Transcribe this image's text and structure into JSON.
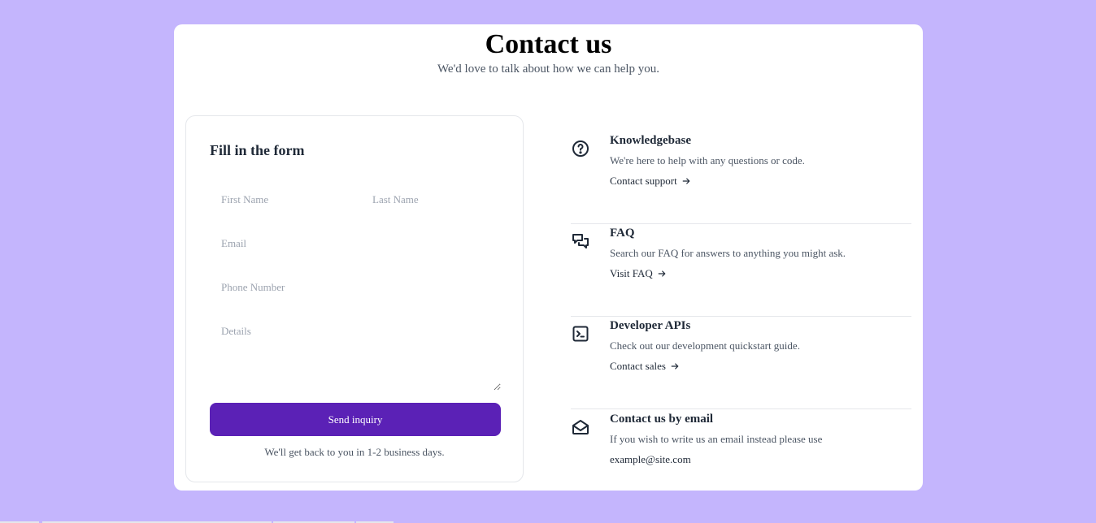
{
  "header": {
    "title": "Contact us",
    "subtitle": "We'd love to talk about how we can help you."
  },
  "form": {
    "heading": "Fill in the form",
    "first_name_placeholder": "First Name",
    "last_name_placeholder": "Last Name",
    "email_placeholder": "Email",
    "phone_placeholder": "Phone Number",
    "details_placeholder": "Details",
    "submit_label": "Send inquiry",
    "note": "We'll get back to you in 1-2 business days."
  },
  "info": {
    "items": [
      {
        "icon": "help-circle-icon",
        "title": "Knowledgebase",
        "description": "We're here to help with any questions or code.",
        "link": "Contact support"
      },
      {
        "icon": "chat-bubbles-icon",
        "title": "FAQ",
        "description": "Search our FAQ for answers to anything you might ask.",
        "link": "Visit FAQ"
      },
      {
        "icon": "terminal-icon",
        "title": "Developer APIs",
        "description": "Check out our development quickstart guide.",
        "link": "Contact sales"
      },
      {
        "icon": "open-envelope-icon",
        "title": "Contact us by email",
        "description": "If you wish to write us an email instead please use",
        "email": "example@site.com"
      }
    ]
  },
  "colors": {
    "page_background": "#c4b5fd",
    "card_background": "#ffffff",
    "button_background": "#5b21b6",
    "text_dark": "#1f2937",
    "text_muted": "#4b5563"
  }
}
